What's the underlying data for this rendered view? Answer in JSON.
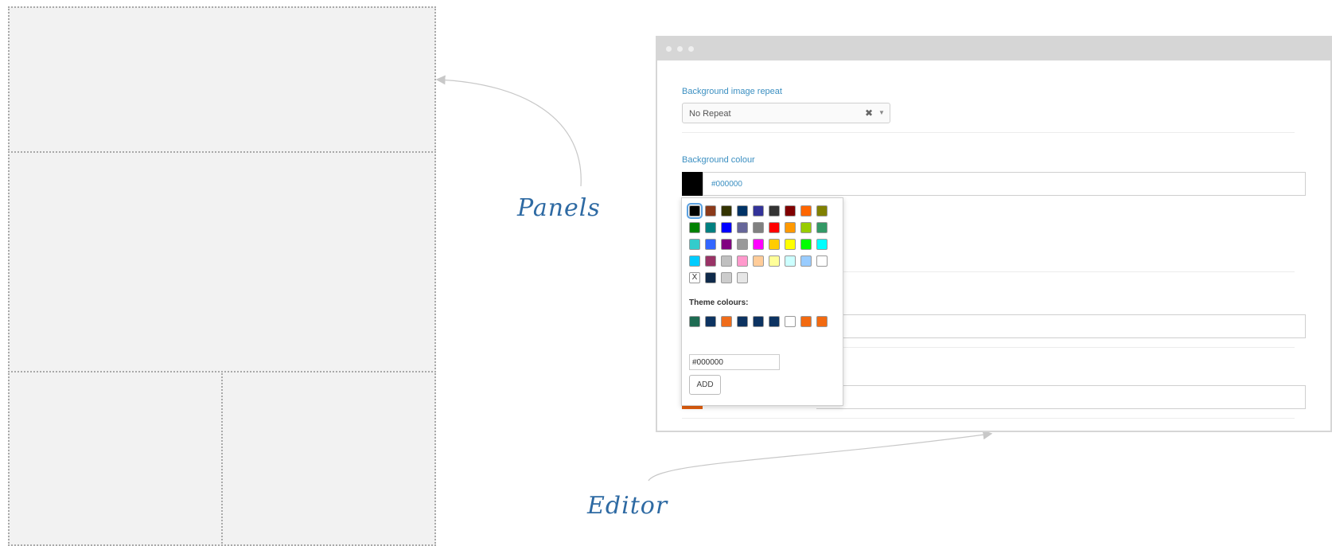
{
  "annotations": {
    "panels": "Panels",
    "editor": "Editor"
  },
  "editor": {
    "repeat": {
      "label": "Background image repeat",
      "value": "No Repeat",
      "clear_glyph": "✖",
      "caret_glyph": "▼"
    },
    "colour": {
      "label": "Background colour",
      "value": "#000000"
    },
    "picker": {
      "swatch_rows": [
        [
          "#000000",
          "#8b3a1a",
          "#333300",
          "#003366",
          "#333399",
          "#333333",
          "#800000",
          "#ff6600"
        ],
        [
          "#808000",
          "#008000",
          "#008080",
          "#0000ff",
          "#666699",
          "#808080",
          "#ff0000",
          "#ff9900"
        ],
        [
          "#99cc00",
          "#339966",
          "#33cccc",
          "#3366ff",
          "#800080",
          "#999999",
          "#ff00ff",
          "#ffcc00"
        ],
        [
          "#ffff00",
          "#00ff00",
          "#00ffff",
          "#00ccff",
          "#993366",
          "#c0c0c0",
          "#ff99cc",
          "#ffcc99"
        ],
        [
          "#ffff99",
          "#ccffff",
          "#99ccff",
          "#ffffff",
          "X",
          "#0f2a4a",
          "#cccccc",
          "#e6e6e6"
        ]
      ],
      "theme_label": "Theme colours:",
      "theme_swatches": [
        "#1e6b52",
        "#0d3361",
        "#ef6c1a",
        "#0d3361",
        "#0d3361",
        "#0d3361",
        "#ffffff",
        "#f26a11",
        "#f26a11"
      ],
      "hex_value": "#000000",
      "add_label": "ADD"
    }
  }
}
